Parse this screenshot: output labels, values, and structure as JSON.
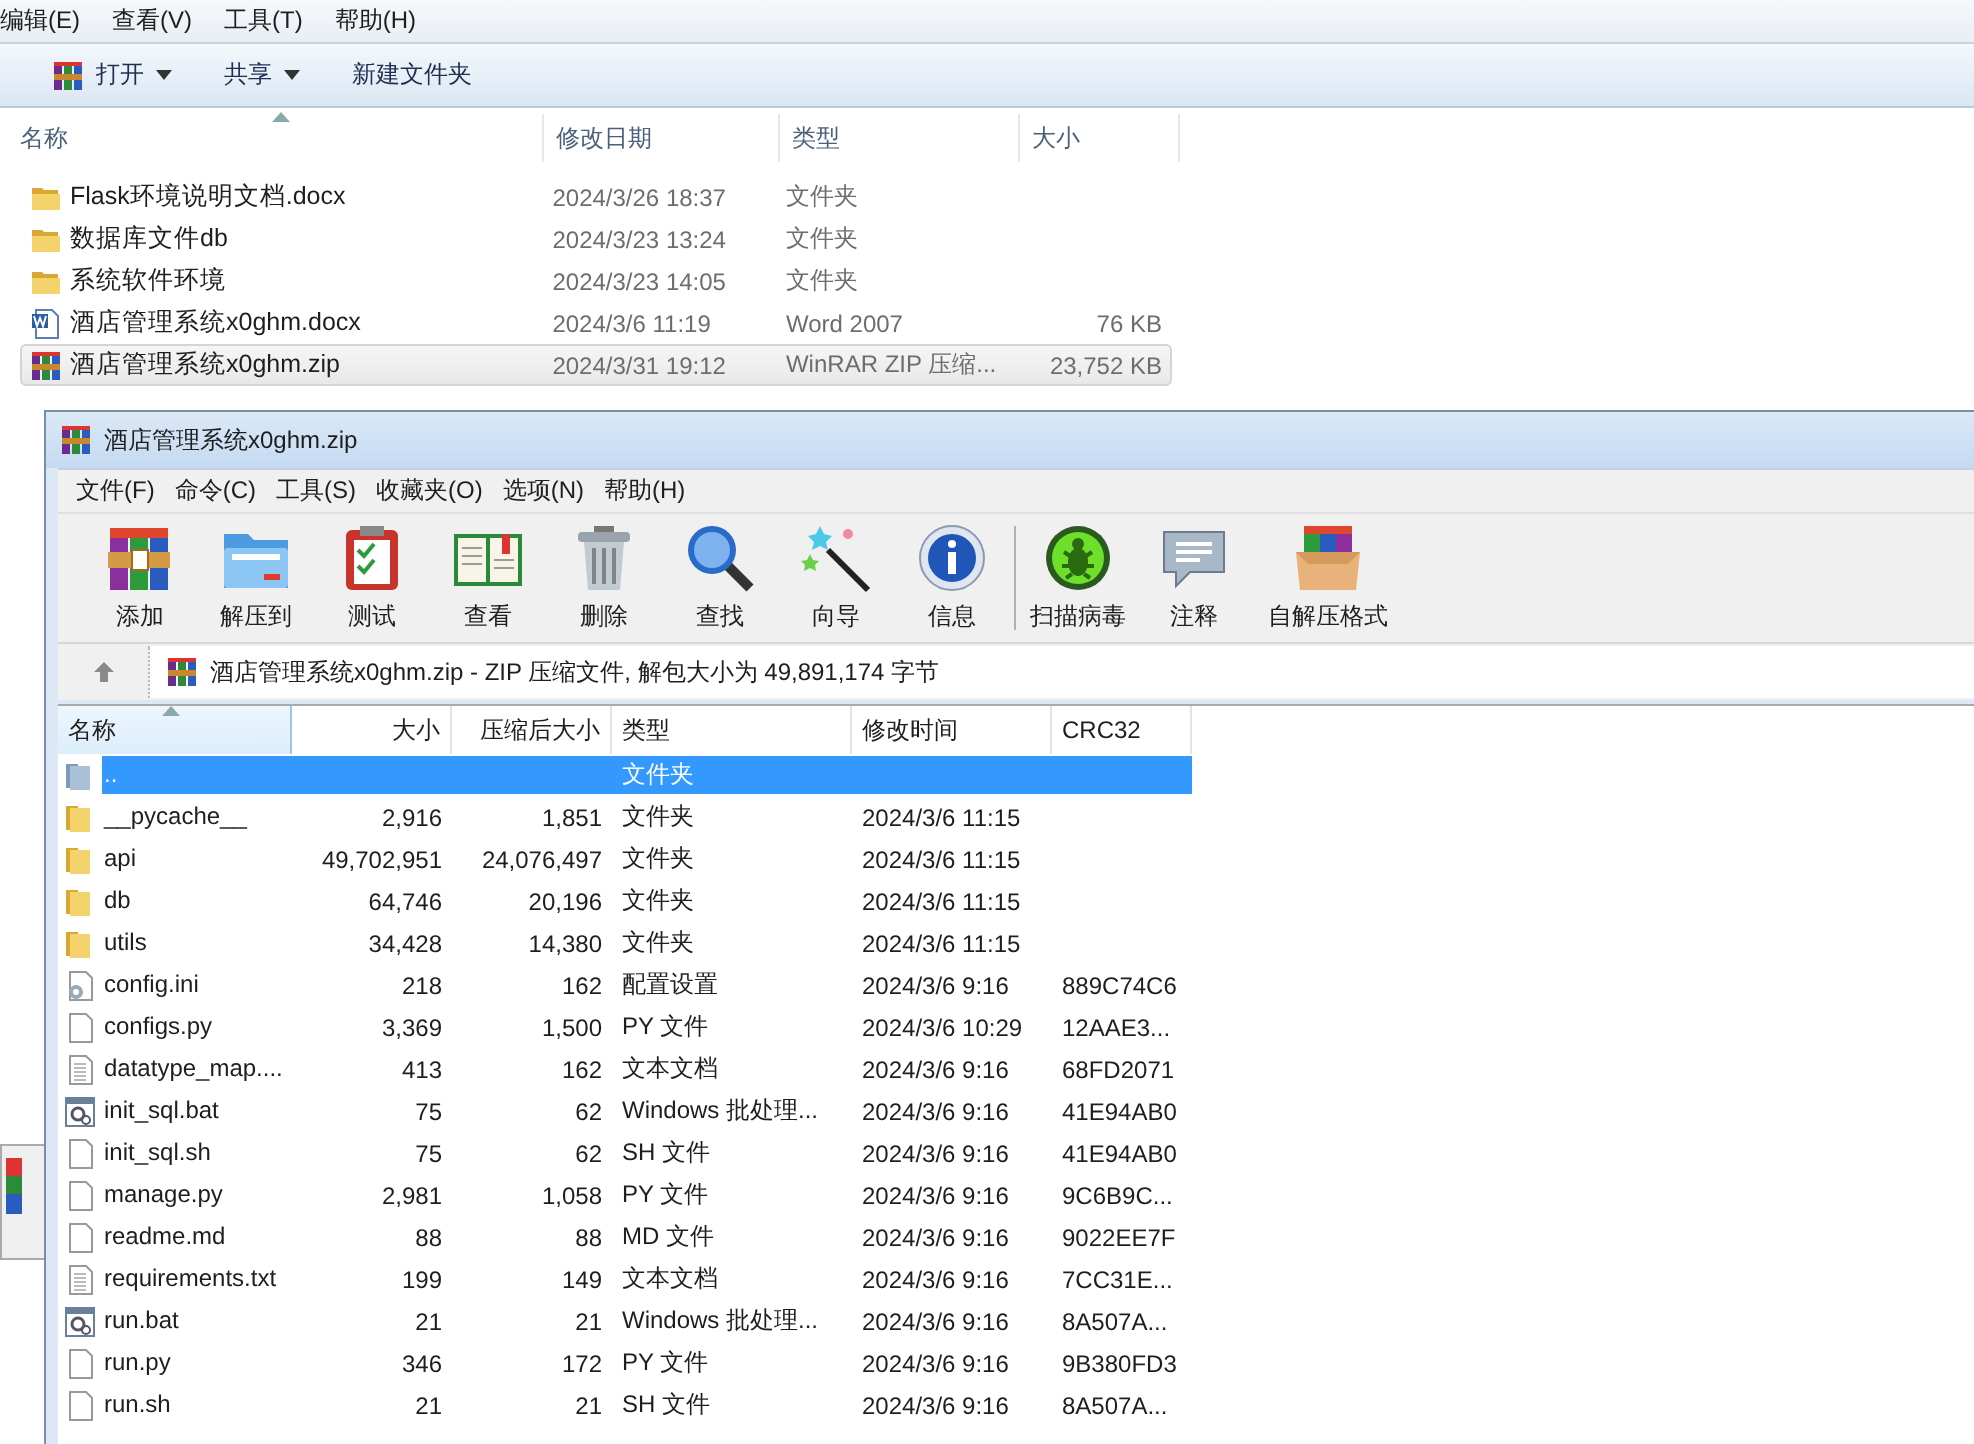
{
  "explorer": {
    "menu": [
      "编辑(E)",
      "查看(V)",
      "工具(T)",
      "帮助(H)"
    ],
    "toolbar": [
      {
        "label": "打开",
        "kind": "open",
        "dropdown": true
      },
      {
        "label": "共享",
        "kind": "plain",
        "dropdown": true
      },
      {
        "label": "新建文件夹",
        "kind": "plain",
        "dropdown": false
      }
    ],
    "columns": [
      {
        "label": "名称",
        "sorted": true
      },
      {
        "label": "修改日期",
        "sorted": false
      },
      {
        "label": "类型",
        "sorted": false
      },
      {
        "label": "大小",
        "sorted": false
      }
    ],
    "files": [
      {
        "name": "Flask环境说明文档.docx",
        "date": "2024/3/26 18:37",
        "type": "文件夹",
        "kind": "folder",
        "selected": false
      },
      {
        "name": "数据库文件db",
        "date": "2024/3/23 13:24",
        "type": "文件夹",
        "kind": "folder",
        "selected": false
      },
      {
        "name": "系统软件环境",
        "date": "2024/3/23 14:05",
        "type": "文件夹",
        "kind": "folder",
        "selected": false
      },
      {
        "name": "酒店管理系统x0ghm.docx",
        "date": "2024/3/6 11:19",
        "type": "Word 2007",
        "size": "76 KB",
        "kind": "docx",
        "selected": false
      },
      {
        "name": "酒店管理系统x0ghm.zip",
        "date": "2024/3/31 19:12",
        "type": "WinRAR ZIP 压缩...",
        "size": "23,752 KB",
        "kind": "zip",
        "selected": true
      }
    ]
  },
  "winrar": {
    "title": "酒店管理系统x0ghm.zip",
    "menu": [
      "文件(F)",
      "命令(C)",
      "工具(S)",
      "收藏夹(O)",
      "选项(N)",
      "帮助(H)"
    ],
    "tools": [
      {
        "label": "添加",
        "kind": "add"
      },
      {
        "label": "解压到",
        "kind": "extract"
      },
      {
        "label": "测试",
        "kind": "test"
      },
      {
        "label": "查看",
        "kind": "view"
      },
      {
        "label": "删除",
        "kind": "delete"
      },
      {
        "label": "查找",
        "kind": "find"
      },
      {
        "label": "向导",
        "kind": "wizard"
      },
      {
        "label": "信息",
        "kind": "info"
      }
    ],
    "extra_tools": [
      {
        "label": "扫描病毒",
        "kind": "virus"
      },
      {
        "label": "注释",
        "kind": "comment"
      },
      {
        "label": "自解压格式",
        "kind": "sfx"
      }
    ],
    "address": "酒店管理系统x0ghm.zip - ZIP 压缩文件, 解包大小为 49,891,174 字节",
    "columns": [
      {
        "label": "名称",
        "sorted": true
      },
      {
        "label": "大小",
        "sorted": false
      },
      {
        "label": "压缩后大小",
        "sorted": false
      },
      {
        "label": "类型",
        "sorted": false
      },
      {
        "label": "修改时间",
        "sorted": false
      },
      {
        "label": "CRC32",
        "sorted": false
      }
    ],
    "rows": [
      {
        "name": "..",
        "type": "文件夹",
        "kind": "up",
        "selected": true
      },
      {
        "name": "__pycache__",
        "size": "2,916",
        "packed": "1,851",
        "type": "文件夹",
        "modified": "2024/3/6 11:15",
        "kind": "folder",
        "selected": false
      },
      {
        "name": "api",
        "size": "49,702,951",
        "packed": "24,076,497",
        "type": "文件夹",
        "modified": "2024/3/6 11:15",
        "kind": "folder",
        "selected": false
      },
      {
        "name": "db",
        "size": "64,746",
        "packed": "20,196",
        "type": "文件夹",
        "modified": "2024/3/6 11:15",
        "kind": "folder",
        "selected": false
      },
      {
        "name": "utils",
        "size": "34,428",
        "packed": "14,380",
        "type": "文件夹",
        "modified": "2024/3/6 11:15",
        "kind": "folder",
        "selected": false
      },
      {
        "name": "config.ini",
        "size": "218",
        "packed": "162",
        "type": "配置设置",
        "modified": "2024/3/6 9:16",
        "crc": "889C74C6",
        "kind": "ini",
        "selected": false
      },
      {
        "name": "configs.py",
        "size": "3,369",
        "packed": "1,500",
        "type": "PY 文件",
        "modified": "2024/3/6 10:29",
        "crc": "12AAE3...",
        "kind": "file",
        "selected": false
      },
      {
        "name": "datatype_map....",
        "size": "413",
        "packed": "162",
        "type": "文本文档",
        "modified": "2024/3/6 9:16",
        "crc": "68FD2071",
        "kind": "txt",
        "selected": false
      },
      {
        "name": "init_sql.bat",
        "size": "75",
        "packed": "62",
        "type": "Windows 批处理...",
        "modified": "2024/3/6 9:16",
        "crc": "41E94AB0",
        "kind": "bat",
        "selected": false
      },
      {
        "name": "init_sql.sh",
        "size": "75",
        "packed": "62",
        "type": "SH 文件",
        "modified": "2024/3/6 9:16",
        "crc": "41E94AB0",
        "kind": "file",
        "selected": false
      },
      {
        "name": "manage.py",
        "size": "2,981",
        "packed": "1,058",
        "type": "PY 文件",
        "modified": "2024/3/6 9:16",
        "crc": "9C6B9C...",
        "kind": "file",
        "selected": false
      },
      {
        "name": "readme.md",
        "size": "88",
        "packed": "88",
        "type": "MD 文件",
        "modified": "2024/3/6 9:16",
        "crc": "9022EE7F",
        "kind": "file",
        "selected": false
      },
      {
        "name": "requirements.txt",
        "size": "199",
        "packed": "149",
        "type": "文本文档",
        "modified": "2024/3/6 9:16",
        "crc": "7CC31E...",
        "kind": "txt",
        "selected": false
      },
      {
        "name": "run.bat",
        "size": "21",
        "packed": "21",
        "type": "Windows 批处理...",
        "modified": "2024/3/6 9:16",
        "crc": "8A507A...",
        "kind": "bat",
        "selected": false
      },
      {
        "name": "run.py",
        "size": "346",
        "packed": "172",
        "type": "PY 文件",
        "modified": "2024/3/6 9:16",
        "crc": "9B380FD3",
        "kind": "file",
        "selected": false
      },
      {
        "name": "run.sh",
        "size": "21",
        "packed": "21",
        "type": "SH 文件",
        "modified": "2024/3/6 9:16",
        "crc": "8A507A...",
        "kind": "file",
        "selected": false
      }
    ]
  }
}
